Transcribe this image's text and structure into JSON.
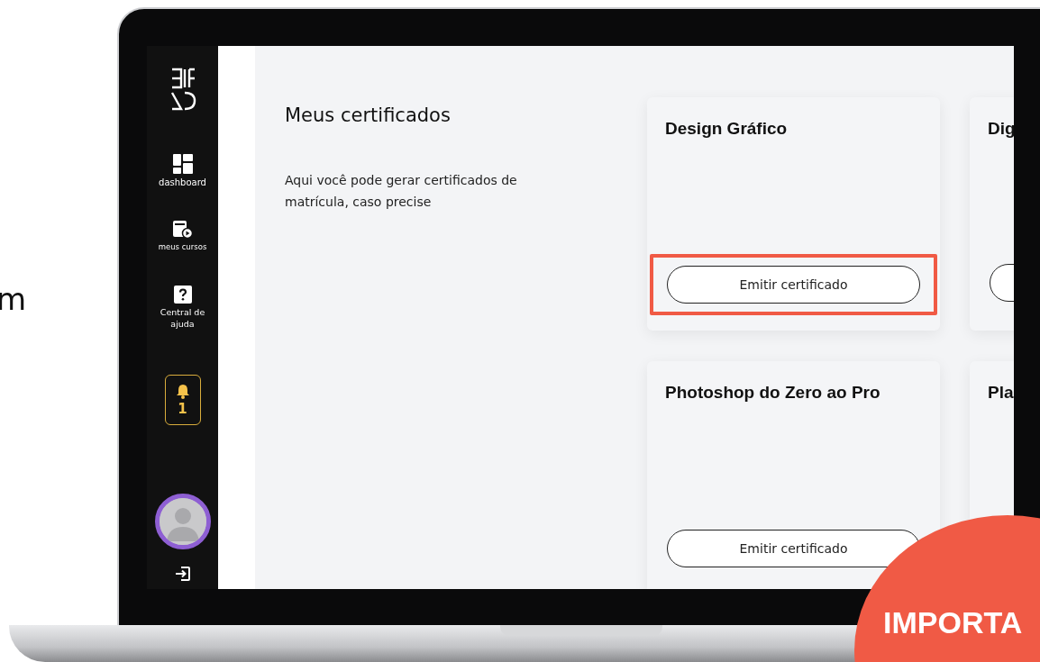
{
  "page_fragment": "m",
  "sidebar": {
    "items": [
      {
        "kind": "dashboard",
        "label": "dashboard"
      },
      {
        "kind": "courses",
        "label": "meus cursos"
      },
      {
        "kind": "help",
        "label": "Central de ajuda"
      }
    ],
    "notifications": {
      "count": "1"
    }
  },
  "main": {
    "title": "Meus certificados",
    "description": "Aqui você pode gerar certificados de matrícula, caso precise",
    "cards": [
      {
        "title": "Design Gráfico",
        "show_button": true,
        "button": "Emitir certificado",
        "highlighted": true
      },
      {
        "title": "Dig",
        "show_button": true,
        "highlighted": false
      },
      {
        "title": "Photoshop do Zero ao Pro",
        "show_button": true,
        "button": "Emitir certificado",
        "highlighted": false
      },
      {
        "title": "Pla"
      }
    ]
  },
  "banner": {
    "text": "IMPORTA"
  }
}
